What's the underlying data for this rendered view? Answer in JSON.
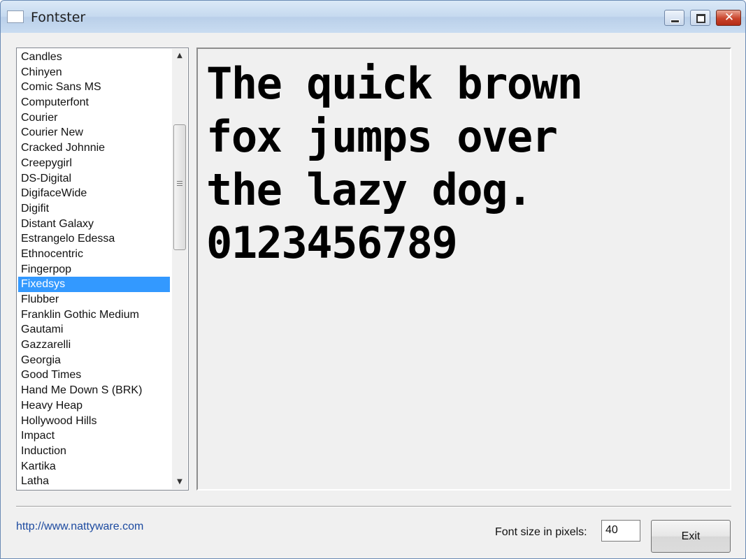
{
  "window": {
    "title": "Fontster",
    "minimize_glyph": "",
    "maximize_glyph": "",
    "close_glyph": "✕"
  },
  "font_list": {
    "items": [
      {
        "label": "Candles"
      },
      {
        "label": "Chinyen"
      },
      {
        "label": "Comic Sans MS"
      },
      {
        "label": "Computerfont"
      },
      {
        "label": "Courier"
      },
      {
        "label": "Courier New"
      },
      {
        "label": "Cracked Johnnie"
      },
      {
        "label": "Creepygirl"
      },
      {
        "label": "DS-Digital"
      },
      {
        "label": "DigifaceWide"
      },
      {
        "label": "Digifit"
      },
      {
        "label": "Distant Galaxy"
      },
      {
        "label": "Estrangelo Edessa"
      },
      {
        "label": "Ethnocentric"
      },
      {
        "label": "Fingerpop"
      },
      {
        "label": "Fixedsys",
        "selected": true
      },
      {
        "label": "Flubber"
      },
      {
        "label": "Franklin Gothic Medium"
      },
      {
        "label": "Gautami"
      },
      {
        "label": "Gazzarelli"
      },
      {
        "label": "Georgia"
      },
      {
        "label": "Good Times"
      },
      {
        "label": "Hand Me Down S (BRK)"
      },
      {
        "label": "Heavy Heap"
      },
      {
        "label": "Hollywood Hills"
      },
      {
        "label": "Impact"
      },
      {
        "label": "Induction"
      },
      {
        "label": "Kartika"
      },
      {
        "label": "Latha"
      }
    ],
    "selected": "Fixedsys",
    "scroll_up_glyph": "▲",
    "scroll_down_glyph": "▼"
  },
  "preview": {
    "lines": [
      "The quick brown",
      "fox jumps over",
      "the lazy dog.",
      "0123456789"
    ]
  },
  "footer": {
    "link": "http://www.nattyware.com",
    "font_size_label": "Font size in pixels:",
    "font_size_value": "40",
    "exit_label": "Exit"
  },
  "colors": {
    "selection": "#3399ff",
    "link": "#1c4aa0",
    "window_bg": "#f0f0f0"
  }
}
